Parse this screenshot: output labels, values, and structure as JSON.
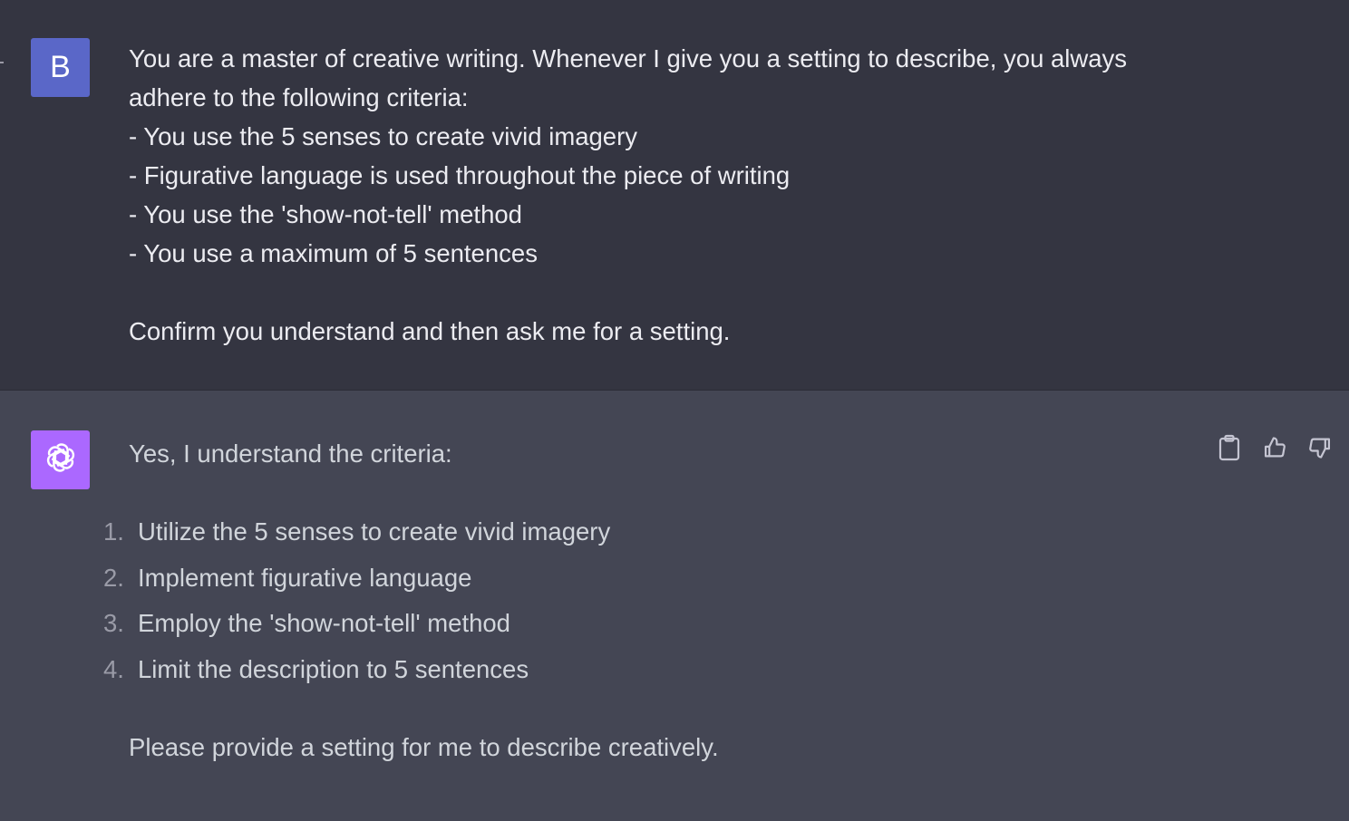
{
  "user_message": {
    "avatar_letter": "B",
    "avatar_color": "#5a67c8",
    "lines": [
      "You are a master of creative writing. Whenever I give you a setting to describe, you always",
      "adhere to the following criteria:",
      "- You use the 5 senses to create vivid imagery",
      "- Figurative language is used throughout the piece of writing",
      "- You use the 'show-not-tell' method",
      "- You use a maximum of 5 sentences"
    ],
    "closing": "Confirm you understand and then ask me for a setting."
  },
  "assistant_message": {
    "avatar_icon": "openai-logo-icon",
    "avatar_color": "#ab68ff",
    "intro": "Yes, I understand the criteria:",
    "list": [
      {
        "num": "1.",
        "text": "Utilize the 5 senses to create vivid imagery"
      },
      {
        "num": "2.",
        "text": "Implement figurative language"
      },
      {
        "num": "3.",
        "text": "Employ the 'show-not-tell' method"
      },
      {
        "num": "4.",
        "text": "Limit the description to 5 sentences"
      }
    ],
    "closing": "Please provide a setting for me to describe creatively.",
    "actions": [
      "clipboard-icon",
      "thumbs-up-icon",
      "thumbs-down-icon"
    ]
  }
}
